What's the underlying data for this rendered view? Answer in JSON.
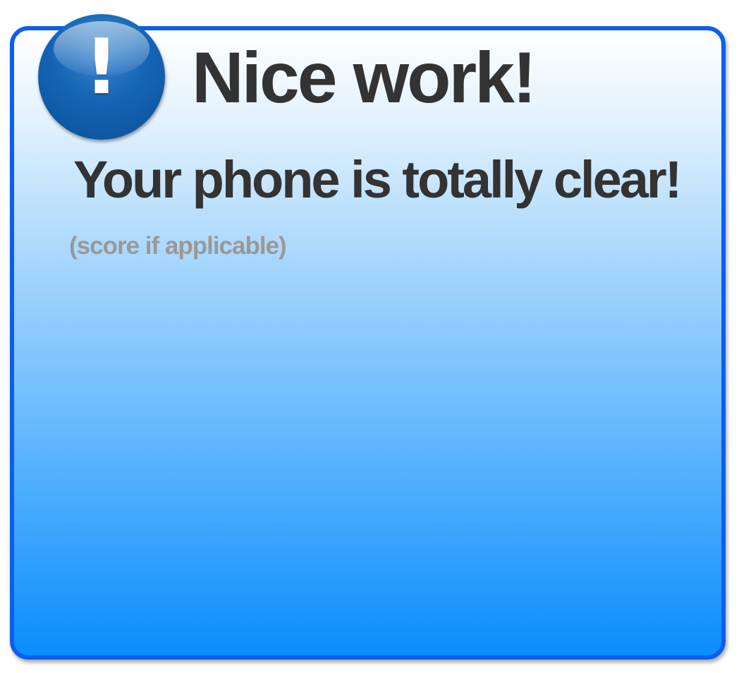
{
  "dialog": {
    "title": "Nice work!",
    "message": "Your phone is totally clear!",
    "score_placeholder": "(score if applicable)",
    "icon": {
      "name": "exclamation-icon",
      "glyph": "!"
    },
    "colors": {
      "border": "#0a5ff0",
      "badge": "#1565b5",
      "text": "#333333",
      "score_text": "#999999",
      "gradient_bottom": "#0a8dfc"
    }
  }
}
